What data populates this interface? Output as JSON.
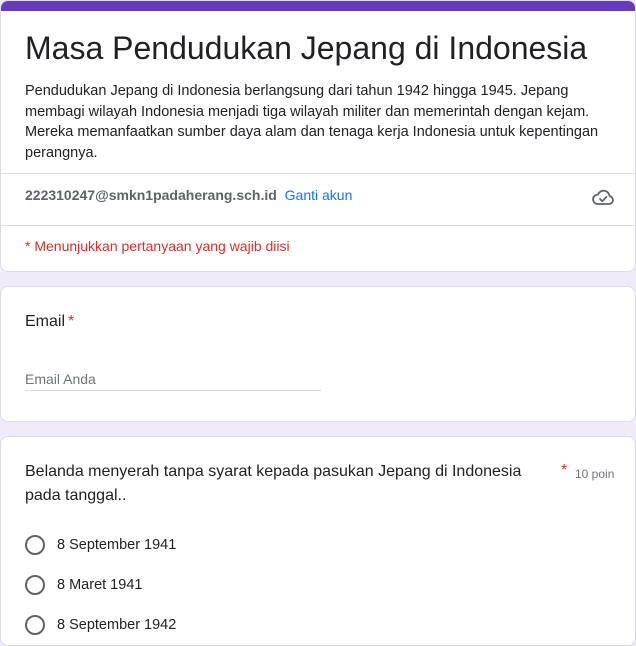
{
  "header": {
    "title": "Masa Pendudukan Jepang di Indonesia",
    "description": "Pendudukan Jepang di Indonesia berlangsung dari tahun 1942 hingga 1945. Jepang membagi wilayah Indonesia menjadi tiga wilayah militer dan memerintah dengan kejam. Mereka memanfaatkan sumber daya alam dan tenaga kerja Indonesia untuk kepentingan perangnya.",
    "account_email": "222310247@smkn1padaherang.sch.id",
    "switch_account": "Ganti akun",
    "required_note": "* Menunjukkan pertanyaan yang wajib diisi",
    "accent_color": "#673ab7",
    "cloud_icon": "cloud-saved-icon"
  },
  "email_question": {
    "label": "Email",
    "required_mark": "*",
    "placeholder": "Email Anda",
    "value": ""
  },
  "question1": {
    "text": "Belanda menyerah tanpa syarat kepada pasukan Jepang  di Indonesia pada tanggal..",
    "required_mark": "*",
    "points": "10 poin",
    "options": [
      {
        "label": "8 September 1941"
      },
      {
        "label": "8 Maret 1941"
      },
      {
        "label": "8 September 1942"
      }
    ]
  }
}
